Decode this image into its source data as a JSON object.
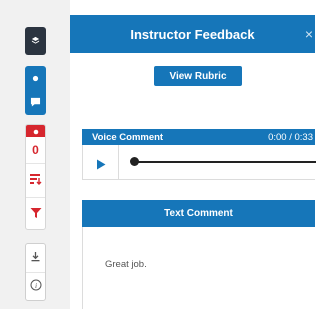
{
  "panel": {
    "title": "Instructor Feedback",
    "close_glyph": "×",
    "rubric_button": "View Rubric"
  },
  "voice_comment": {
    "label": "Voice Comment",
    "time": "0:00 / 0:33"
  },
  "text_comment": {
    "label": "Text Comment",
    "body": "Great job."
  },
  "toolbar": {
    "grade_count": "0",
    "icons": [
      "layers-icon",
      "comment-icon",
      "grade-icon",
      "sort-icon",
      "filter-icon",
      "download-icon",
      "info-icon"
    ]
  },
  "colors": {
    "accent": "#1676b9",
    "dark": "#2b3440",
    "alert": "#d6262e"
  }
}
